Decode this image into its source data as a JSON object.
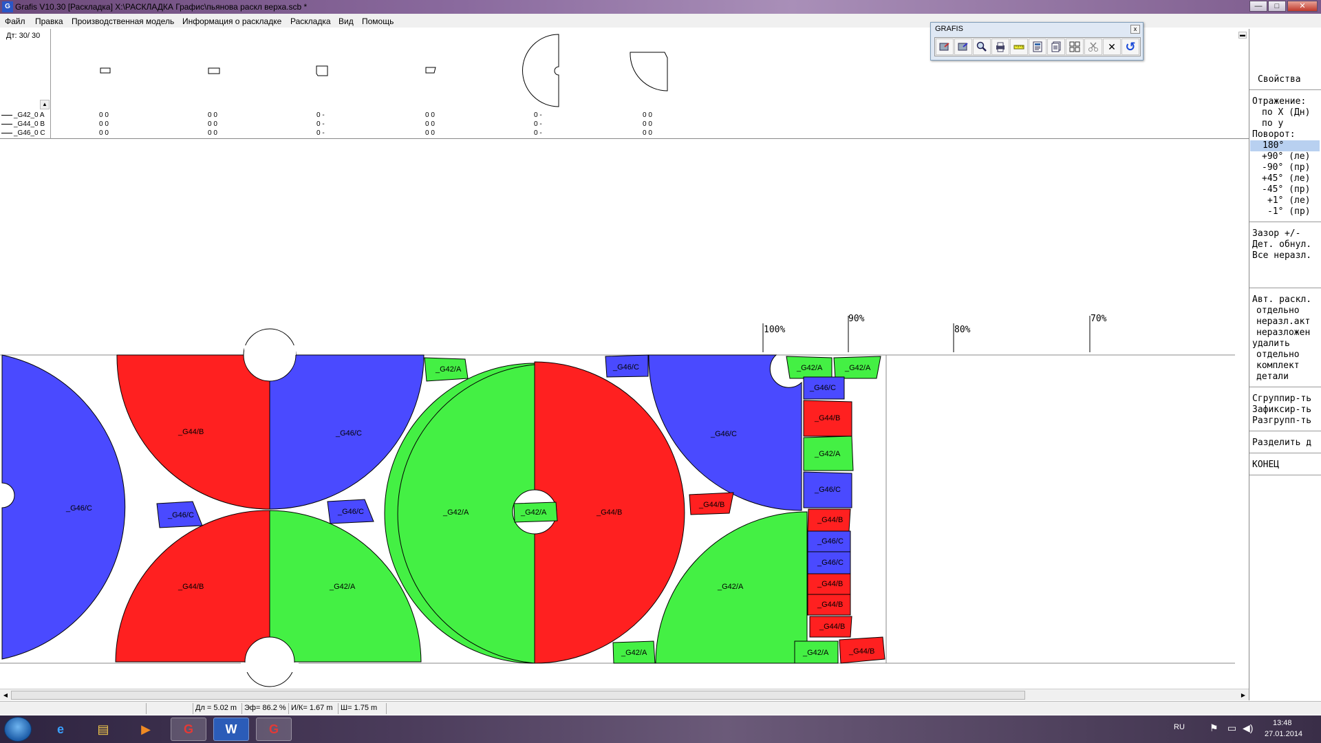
{
  "window": {
    "app_icon": "G",
    "title": "Grafis V10.30 [Раскладка] X:\\РАСКЛАДКА Графис\\пьянова раскл верха.scb *",
    "controls": {
      "minimize": "—",
      "maximize": "□",
      "close": "✕"
    }
  },
  "menu": [
    "Файл",
    "Правка",
    "Производственная модель",
    "Информация о раскладке",
    "Раскладка",
    "Вид",
    "Помощь"
  ],
  "pieces_panel": {
    "counter": "Дт: 30/ 30",
    "scroll_up": "▲",
    "minimize": "▬",
    "rows": [
      {
        "label": "_G42_0  A"
      },
      {
        "label": "_G44_0  B"
      },
      {
        "label": "_G46_0  C"
      }
    ],
    "columns": [
      [
        "0  0",
        "0  0",
        "0  0"
      ],
      [
        "0  0",
        "0  0",
        "0  0"
      ],
      [
        "0  -",
        "0  -",
        "0  -"
      ],
      [
        "0  0",
        "0  0",
        "0  0"
      ],
      [
        "0  -",
        "0  -",
        "0  -"
      ],
      [
        "0  0",
        "0  0",
        "0  0"
      ]
    ]
  },
  "toolbar_window": {
    "title": "GRAFIS",
    "close": "x",
    "tools": [
      {
        "icon": "layout-export-icon"
      },
      {
        "icon": "layout-import-icon"
      },
      {
        "icon": "zoom-icon"
      },
      {
        "icon": "print-icon"
      },
      {
        "icon": "ruler-icon"
      },
      {
        "icon": "report-icon"
      },
      {
        "icon": "copy-document-icon"
      },
      {
        "icon": "pieces-grid-icon"
      },
      {
        "icon": "scissors-icon"
      },
      {
        "icon": "close-icon",
        "glyph": "✕"
      },
      {
        "icon": "undo-icon",
        "glyph": "↺"
      }
    ]
  },
  "efficiency_scale": [
    "100%",
    "90%",
    "80%",
    "70%"
  ],
  "pieces": [
    {
      "name": "_G46/C",
      "color": "#4a4aff"
    },
    {
      "name": "_G44/B",
      "color": "#ff2020"
    },
    {
      "name": "_G42/A",
      "color": "#44f044"
    }
  ],
  "piece_labels": {
    "big_left": "_G46/C",
    "r1_top": "_G44/B",
    "b1_top": "_G46/C",
    "b_small1": "_G46/C",
    "b_small2": "_G46/C",
    "r2_bottom": "_G44/B",
    "g1_bottom": "_G42/A",
    "g_small_top": "_G42/A",
    "g_full": "_G42/A",
    "g_center": "_G42/A",
    "r_full": "_G44/B",
    "b_small_top": "_G46/C",
    "b_quarter": "_G46/C",
    "r_small_mid": "_G44/B",
    "g_quarter": "_G42/A",
    "g_small_bottom": "_G42/A",
    "col": [
      "_G42/A",
      "_G42/A",
      "_G46/C",
      "_G44/B",
      "_G42/A",
      "_G46/C",
      "_G44/B",
      "_G46/C",
      "_G46/C",
      "_G44/B",
      "_G44/B",
      "_G44/B",
      "_G42/A",
      "_G44/B"
    ]
  },
  "status": {
    "length": "Дл = 5.02 m",
    "efficiency": "Эф= 86.2 %",
    "ik": "И/К= 1.67 m",
    "width": "Ш= 1.75 m"
  },
  "side_panel": {
    "title": "Свойства",
    "reflection": "Отражение:",
    "reflect_x": "по X (Дн)",
    "reflect_y": "по y",
    "rotation": "Поворот:",
    "rot_180": "180°",
    "rot_p90": "+90° (ле)",
    "rot_m90": "-90° (пр)",
    "rot_p45": "+45° (ле)",
    "rot_m45": "-45° (пр)",
    "rot_p1": "+1° (ле)",
    "rot_m1": "-1° (пр)",
    "gap": "Зазор +/-",
    "reset_piece": "Дет. обнул.",
    "all_unplaced": "Все неразл.",
    "auto_layout": "Авт. раскл.",
    "separately": "отдельно",
    "unplaced_active": "неразл.акт",
    "unplaced": "неразложен",
    "delete": "удалить",
    "separately2": "отдельно",
    "set": "комплект",
    "details": "детали",
    "group": "Сгруппир-ть",
    "fix": "Зафиксир-ть",
    "ungroup": "Разгрупп-ть",
    "split": "Разделить д",
    "end": "КОНЕЦ"
  },
  "taskbar": {
    "language": "RU",
    "time": "13:48",
    "date": "27.01.2014",
    "apps": [
      {
        "icon": "internet-explorer-icon",
        "glyph": "e"
      },
      {
        "icon": "explorer-folder-icon",
        "glyph": "▤"
      },
      {
        "icon": "media-player-icon",
        "glyph": "▶"
      },
      {
        "icon": "grafis-icon",
        "glyph": "G"
      },
      {
        "icon": "word-icon",
        "glyph": "W"
      },
      {
        "icon": "grafis-icon-2",
        "glyph": "G"
      }
    ]
  }
}
